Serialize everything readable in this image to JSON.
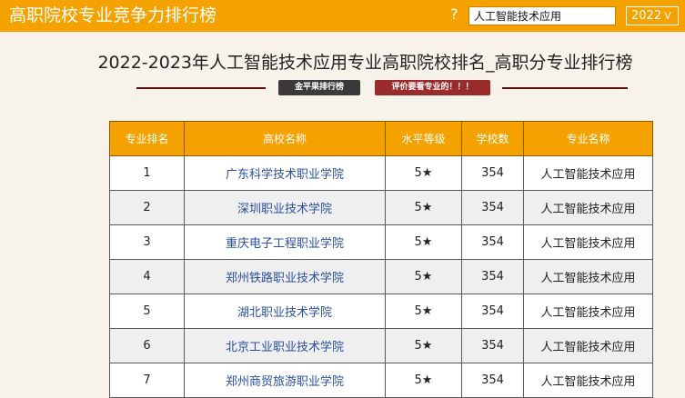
{
  "header": {
    "site_title": "高职院校专业竞争力排行榜",
    "help_icon": "?",
    "search_value": "人工智能技术应用",
    "year_value": "2022",
    "year_chevron": "V"
  },
  "page": {
    "title": "2022-2023年人工智能技术应用专业高职院校排名_高职分专业排行榜",
    "badge_left": "金平果排行榜",
    "badge_right": "评价要看专业的！！！"
  },
  "table": {
    "columns": [
      "专业排名",
      "高校名称",
      "水平等级",
      "学校数",
      "专业名称"
    ],
    "rows": [
      {
        "rank": "1",
        "school": "广东科学技术职业学院",
        "level": "5★",
        "count": "354",
        "major": "人工智能技术应用"
      },
      {
        "rank": "2",
        "school": "深圳职业技术学院",
        "level": "5★",
        "count": "354",
        "major": "人工智能技术应用"
      },
      {
        "rank": "3",
        "school": "重庆电子工程职业学院",
        "level": "5★",
        "count": "354",
        "major": "人工智能技术应用"
      },
      {
        "rank": "4",
        "school": "郑州铁路职业技术学院",
        "level": "5★",
        "count": "354",
        "major": "人工智能技术应用"
      },
      {
        "rank": "5",
        "school": "湖北职业技术学院",
        "level": "5★",
        "count": "354",
        "major": "人工智能技术应用"
      },
      {
        "rank": "6",
        "school": "北京工业职业技术学院",
        "level": "5★",
        "count": "354",
        "major": "人工智能技术应用"
      },
      {
        "rank": "7",
        "school": "郑州商贸旅游职业学院",
        "level": "5★",
        "count": "354",
        "major": "人工智能技术应用"
      }
    ]
  }
}
